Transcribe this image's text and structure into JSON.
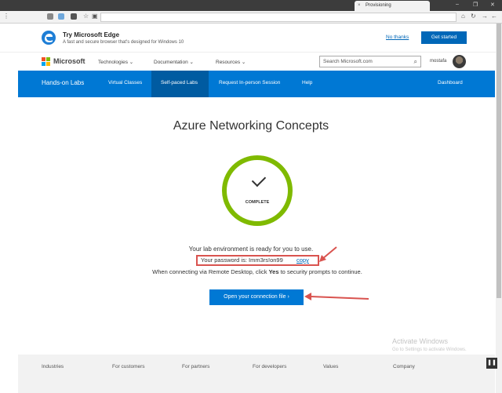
{
  "browser": {
    "tab_title": "Provisioning",
    "tab_close_glyph": "×",
    "window_controls": [
      "–",
      "❐",
      "✕"
    ]
  },
  "promo": {
    "title": "Try Microsoft Edge",
    "subtitle": "A fast and secure browser that's designed for Windows 10",
    "no_thanks": "No thanks",
    "get_started": "Get started"
  },
  "header": {
    "brand": "Microsoft",
    "nav": [
      "Technologies ⌄",
      "Documentation ⌄",
      "Resources ⌄"
    ],
    "search_placeholder": "Search Microsoft.com",
    "username": "mostafa"
  },
  "labs_nav": {
    "brand": "Hands-on Labs",
    "items": [
      "Virtual Classes",
      "Self-paced Labs",
      "Request In-person Session",
      "Help"
    ],
    "active": "Self-paced Labs",
    "dashboard": "Dashboard"
  },
  "main": {
    "title": "Azure Networking Concepts",
    "status": "COMPLETE",
    "ready_text": "Your lab environment is ready for you to use.",
    "password_text": "Your password is: Imm3rs!on99",
    "copy_label": "copy",
    "rdp_text_pre": "When connecting via Remote Desktop, click ",
    "rdp_text_bold": "Yes",
    "rdp_text_post": " to security prompts to continue.",
    "open_button": "Open your connection file ›"
  },
  "watermark": {
    "line1": "Activate Windows",
    "line2": "Go to Settings to activate Windows."
  },
  "footer": {
    "links": [
      "Industries",
      "For customers",
      "For partners",
      "For developers",
      "Values",
      "Company"
    ]
  },
  "colors": {
    "accent_blue": "#0078d4",
    "ring_green": "#7fba00",
    "annotation_red": "#d9534f"
  }
}
